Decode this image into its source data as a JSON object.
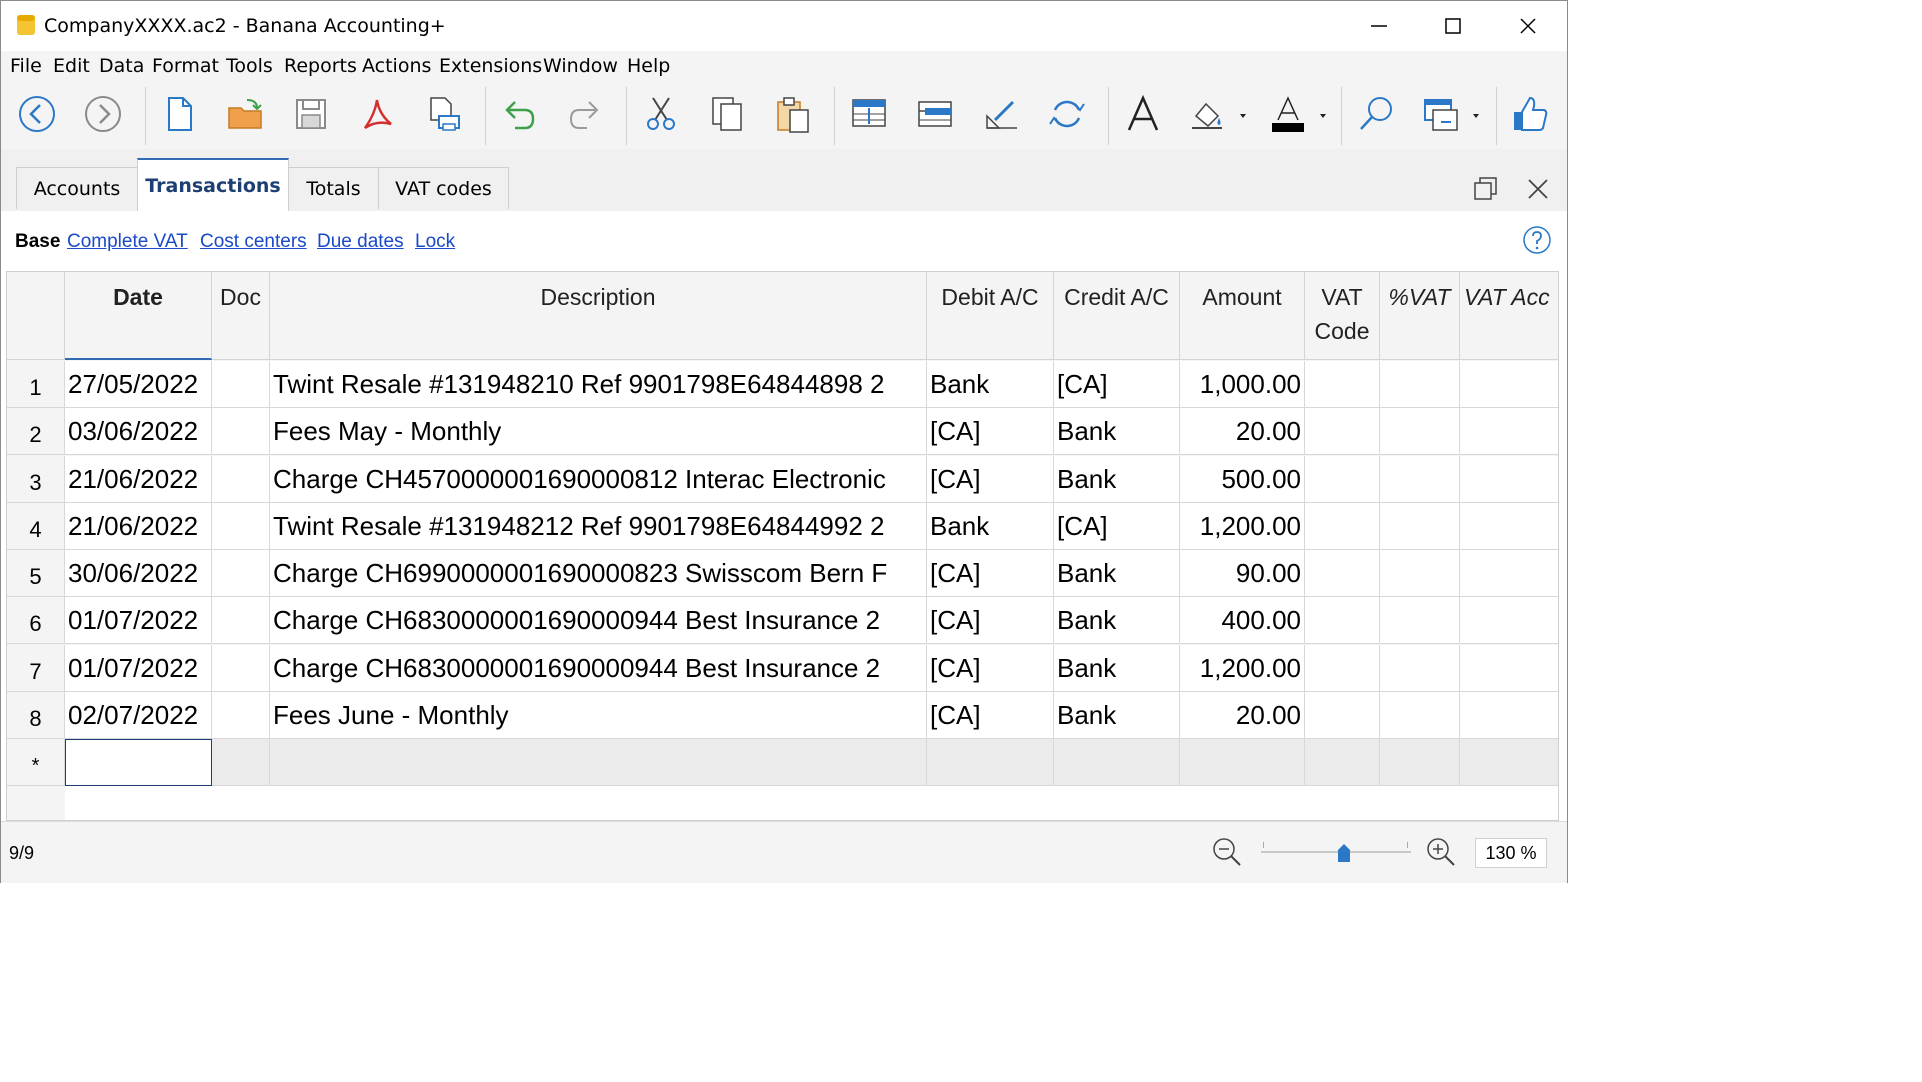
{
  "window": {
    "title": "CompanyXXXX.ac2 - Banana Accounting+"
  },
  "menu": [
    "File",
    "Edit",
    "Data",
    "Format",
    "Tools",
    "Reports",
    "Actions",
    "Extensions",
    "Window",
    "Help"
  ],
  "tabs": [
    {
      "label": "Accounts",
      "active": false
    },
    {
      "label": "Transactions",
      "active": true
    },
    {
      "label": "Totals",
      "active": false
    },
    {
      "label": "VAT codes",
      "active": false
    }
  ],
  "views": {
    "current": "Base",
    "links": [
      "Complete VAT",
      "Cost centers",
      "Due dates",
      "Lock"
    ]
  },
  "table": {
    "headers": {
      "date": "Date",
      "doc": "Doc",
      "description": "Description",
      "debit": "Debit A/C",
      "credit": "Credit A/C",
      "amount": "Amount",
      "vat_code_1": "VAT",
      "vat_code_2": "Code",
      "pct_vat": "%VAT",
      "vat_acc": "VAT Acc"
    },
    "rows": [
      {
        "num": "1",
        "date": "27/05/2022",
        "doc": "",
        "description": "Twint Resale #131948210 Ref 9901798E64844898 2",
        "debit": "Bank",
        "credit": "[CA]",
        "amount": "1,000.00"
      },
      {
        "num": "2",
        "date": "03/06/2022",
        "doc": "",
        "description": "Fees May - Monthly",
        "debit": "[CA]",
        "credit": "Bank",
        "amount": "20.00"
      },
      {
        "num": "3",
        "date": "21/06/2022",
        "doc": "",
        "description": "Charge CH4570000001690000812 Interac Electronic",
        "debit": "[CA]",
        "credit": "Bank",
        "amount": "500.00"
      },
      {
        "num": "4",
        "date": "21/06/2022",
        "doc": "",
        "description": "Twint Resale #131948212 Ref 9901798E64844992 2",
        "debit": "Bank",
        "credit": "[CA]",
        "amount": "1,200.00"
      },
      {
        "num": "5",
        "date": "30/06/2022",
        "doc": "",
        "description": "Charge CH6990000001690000823 Swisscom Bern F",
        "debit": "[CA]",
        "credit": "Bank",
        "amount": "90.00"
      },
      {
        "num": "6",
        "date": "01/07/2022",
        "doc": "",
        "description": "Charge CH6830000001690000944 Best Insurance 2",
        "debit": "[CA]",
        "credit": "Bank",
        "amount": "400.00"
      },
      {
        "num": "7",
        "date": "01/07/2022",
        "doc": "",
        "description": "Charge CH6830000001690000944 Best Insurance 2",
        "debit": "[CA]",
        "credit": "Bank",
        "amount": "1,200.00"
      },
      {
        "num": "8",
        "date": "02/07/2022",
        "doc": "",
        "description": "Fees June - Monthly",
        "debit": "[CA]",
        "credit": "Bank",
        "amount": "20.00"
      }
    ],
    "new_row_marker": "*"
  },
  "status": {
    "row_info": "9/9",
    "zoom": "130 %",
    "zoom_level": 0.55
  },
  "colors": {
    "accent": "#2f6ab3",
    "link": "#1a49c9",
    "icon_blue": "#2b78c6",
    "pdf_red": "#d32f2f",
    "folder_orange": "#f0a04b"
  },
  "toolbar_icons": [
    "back-icon",
    "forward-icon",
    "new-file-icon",
    "open-folder-icon",
    "save-icon",
    "pdf-icon",
    "print-preview-icon",
    "undo-icon",
    "redo-icon",
    "cut-icon",
    "copy-icon",
    "paste-icon",
    "add-row-icon",
    "insert-row-icon",
    "edit-icon",
    "recalculate-icon",
    "font-icon",
    "fill-color-icon",
    "text-color-icon",
    "search-icon",
    "window-layout-icon",
    "like-icon"
  ]
}
